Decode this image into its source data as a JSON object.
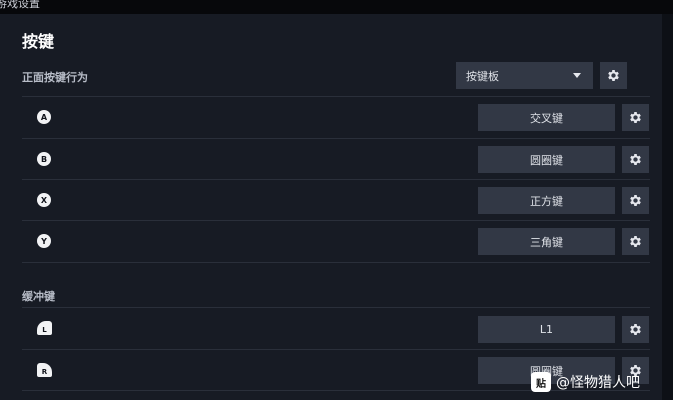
{
  "window": {
    "title": "游戏设置"
  },
  "section": {
    "title": "按键"
  },
  "face_buttons": {
    "label": "正面按键行为",
    "mode_select": {
      "value": "按键板"
    },
    "rows": [
      {
        "glyph": "A",
        "value": "交叉键"
      },
      {
        "glyph": "B",
        "value": "圆圈键"
      },
      {
        "glyph": "X",
        "value": "正方键"
      },
      {
        "glyph": "Y",
        "value": "三角键"
      }
    ]
  },
  "bumpers": {
    "label": "缓冲键",
    "rows": [
      {
        "glyph": "L",
        "value": "L1"
      },
      {
        "glyph": "R",
        "value": "圆圈键"
      }
    ]
  },
  "icons": {
    "settings": "gear-icon",
    "dropdown": "chevron-down-icon"
  },
  "watermark": {
    "logo_text": "贴",
    "text": "@怪物猎人吧"
  },
  "colors": {
    "panel": "#171b24",
    "control": "#323845",
    "background": "#0b0d12"
  }
}
